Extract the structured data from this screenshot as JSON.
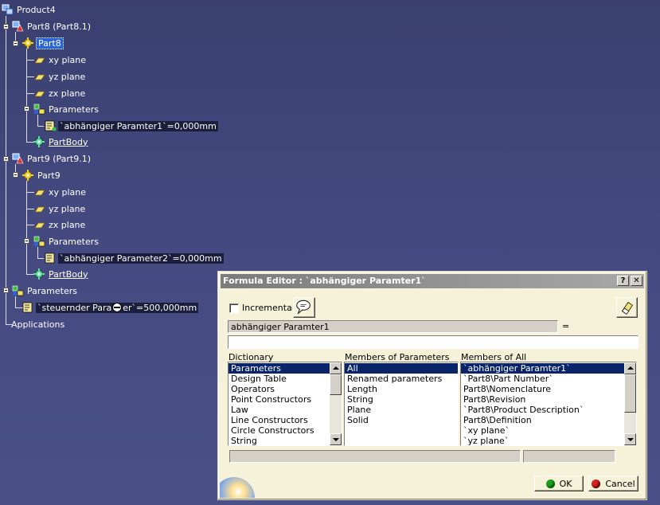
{
  "tree": {
    "root": "Product4",
    "part8_instance": "Part8 (Part8.1)",
    "part8": "Part8",
    "part8_xy": "xy plane",
    "part8_yz": "yz plane",
    "part8_zx": "zx plane",
    "part8_parameters": "Parameters",
    "part8_param1": "`abhängiger Paramter1`=0,000mm",
    "part8_body": "PartBody",
    "part9_instance": "Part9 (Part9.1)",
    "part9": "Part9",
    "part9_xy": "xy plane",
    "part9_yz": "yz plane",
    "part9_zx": "zx plane",
    "part9_parameters": "Parameters",
    "part9_param2": "`abhängiger Parameter2`=0,000mm",
    "part9_body": "PartBody",
    "product_parameters": "Parameters",
    "steuernder_prefix": "`steuernder Para",
    "steuernder_suffix": "er`=500,000mm",
    "applications": "Applications"
  },
  "dialog": {
    "title": "Formula Editor : `abhängiger Paramter1`",
    "help_label": "?",
    "close_label": "✕",
    "incremental_label": "Incremental",
    "incremental_checked": false,
    "parameter_name": "abhängiger Paramter1",
    "equals": "=",
    "formula_value": "",
    "dictionary_header": "Dictionary",
    "dictionary_items": [
      "Parameters",
      "Design Table",
      "Operators",
      "Point Constructors",
      "Law",
      "Line Constructors",
      "Circle Constructors",
      "String"
    ],
    "members_params_header": "Members of Parameters",
    "members_params_items": [
      "All",
      "Renamed parameters",
      "Length",
      "String",
      "Plane",
      "Solid"
    ],
    "members_all_header": "Members of All",
    "members_all_items": [
      "`abhängiger Paramter1`",
      "`Part8\\Part Number`",
      "Part8\\Nomenclature",
      "Part8\\Revision",
      "`Part8\\Product Description`",
      "Part8\\Definition",
      "`xy plane`",
      "`yz plane`"
    ],
    "ok_label": "OK",
    "cancel_label": "Cancel"
  },
  "colors": {
    "background": "#444a80",
    "dialog_bg": "#f6f2d9",
    "selection": "#0a246a",
    "ok_dot": "#1ea01e",
    "cancel_dot": "#d42020"
  }
}
